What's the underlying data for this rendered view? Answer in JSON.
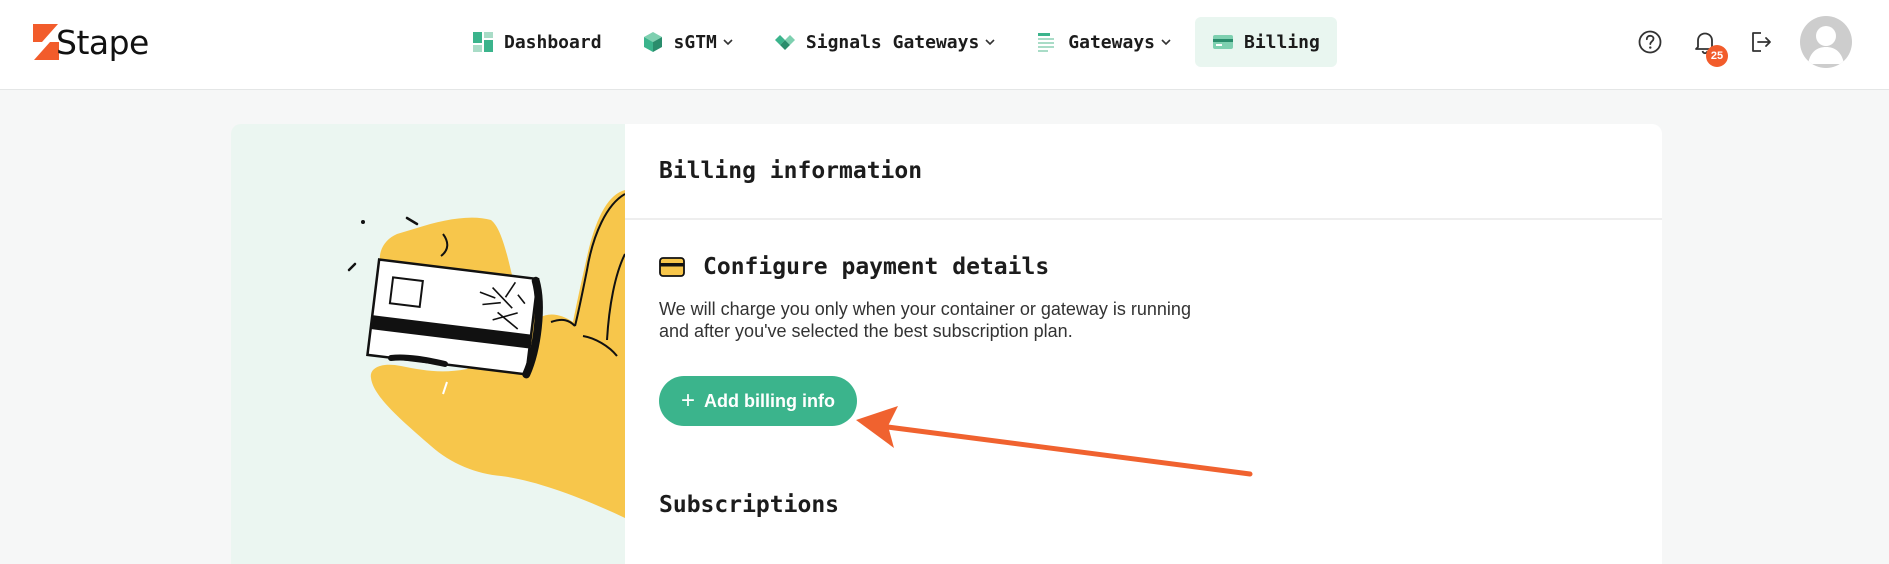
{
  "brand": {
    "name": "Stape",
    "color": "#f25c2b"
  },
  "nav": {
    "items": [
      {
        "label": "Dashboard",
        "icon": "dashboard-icon"
      },
      {
        "label": "sGTM",
        "icon": "cube-icon",
        "dropdown": true
      },
      {
        "label": "Signals Gateways",
        "icon": "diamond-icon",
        "dropdown": true
      },
      {
        "label": "Gateways",
        "icon": "list-icon",
        "dropdown": true
      },
      {
        "label": "Billing",
        "icon": "credit-card-icon",
        "active": true
      }
    ]
  },
  "header_tools": {
    "help_icon": "help-icon",
    "notifications_icon": "bell-icon",
    "notifications_count": "25",
    "logout_icon": "logout-icon",
    "avatar": "avatar"
  },
  "billing": {
    "title": "Billing information",
    "payment": {
      "title": "Configure payment details",
      "description": "We will charge you only when your container or gateway is running and after you've selected the best subscription plan.",
      "button_label": "Add billing info"
    },
    "subscriptions_title": "Subscriptions"
  },
  "colors": {
    "accent": "#3bb48c",
    "active_nav_bg": "#e9f6f0",
    "annotation_arrow": "#f0622f",
    "illustration_bg": "#ebf6f1",
    "hand_yellow": "#f7c64b"
  }
}
